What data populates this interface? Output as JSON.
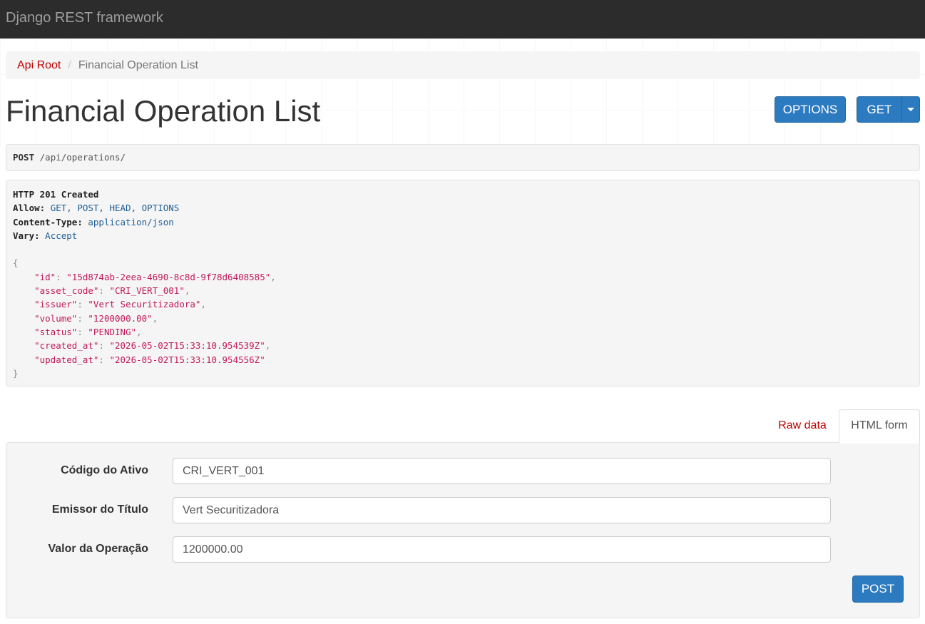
{
  "navbar": {
    "brand": "Django REST framework"
  },
  "breadcrumb": {
    "root": "Api Root",
    "separator": "/",
    "current": "Financial Operation List"
  },
  "page": {
    "title": "Financial Operation List"
  },
  "toolbar": {
    "options_label": "OPTIONS",
    "get_label": "GET"
  },
  "request": {
    "method": "POST",
    "path": "/api/operations/"
  },
  "response": {
    "status": "HTTP 201 Created",
    "headers": [
      {
        "key": "Allow",
        "value": "GET, POST, HEAD, OPTIONS"
      },
      {
        "key": "Content-Type",
        "value": "application/json"
      },
      {
        "key": "Vary",
        "value": "Accept"
      }
    ],
    "body_open": "{",
    "body": [
      {
        "key": "\"id\"",
        "value": "\"15d874ab-2eea-4690-8c8d-9f78d6408585\"",
        "comma": ","
      },
      {
        "key": "\"asset_code\"",
        "value": "\"CRI_VERT_001\"",
        "comma": ","
      },
      {
        "key": "\"issuer\"",
        "value": "\"Vert Securitizadora\"",
        "comma": ","
      },
      {
        "key": "\"volume\"",
        "value": "\"1200000.00\"",
        "comma": ","
      },
      {
        "key": "\"status\"",
        "value": "\"PENDING\"",
        "comma": ","
      },
      {
        "key": "\"created_at\"",
        "value": "\"2026-05-02T15:33:10.954539Z\"",
        "comma": ","
      },
      {
        "key": "\"updated_at\"",
        "value": "\"2026-05-02T15:33:10.954556Z\"",
        "comma": ""
      }
    ],
    "body_close": "}"
  },
  "tabs": {
    "raw": "Raw data",
    "html": "HTML form"
  },
  "form": {
    "fields": [
      {
        "label": "Código do Ativo",
        "value": "CRI_VERT_001"
      },
      {
        "label": "Emissor do Título",
        "value": "Vert Securitizadora"
      },
      {
        "label": "Valor da Operação",
        "value": "1200000.00"
      }
    ],
    "submit_label": "POST"
  },
  "colors": {
    "navbar": "#2c2c2c",
    "primary": "#2c7abf",
    "link": "#c20000",
    "json": "#c2185b"
  }
}
